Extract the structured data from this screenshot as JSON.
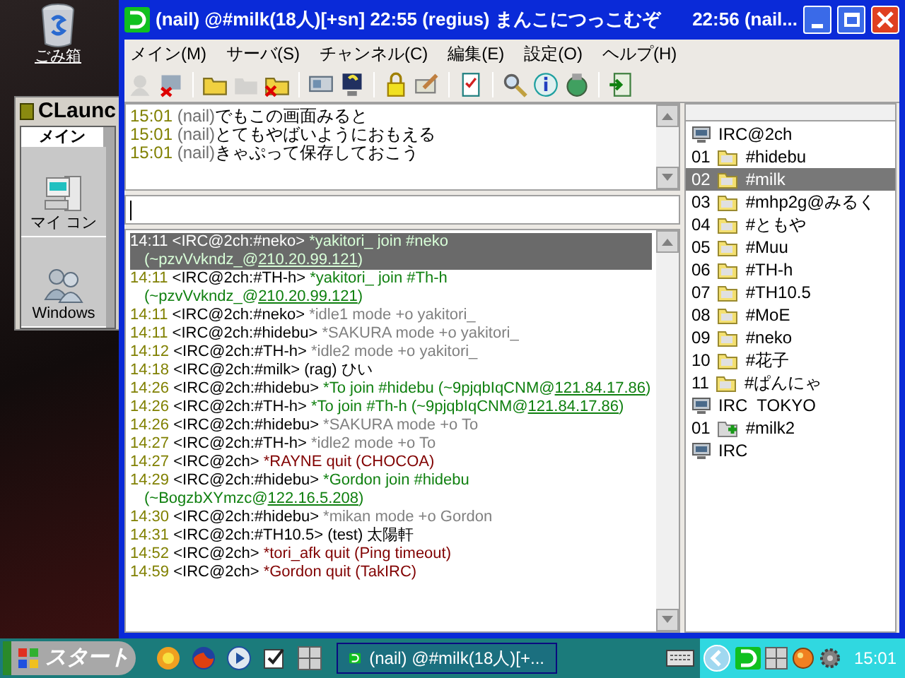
{
  "desktop": {
    "icons": [
      {
        "label": "ごみ箱"
      }
    ]
  },
  "launcher": {
    "title": "CLaunc",
    "tab": "メイン",
    "items": [
      {
        "label": "マイ コン"
      },
      {
        "label": "Windows"
      }
    ]
  },
  "window": {
    "title": "(nail) @#milk(18人)[+sn] 22:55 (regius) まんこにつっこむぞ",
    "title_right": "22:56 (nail..."
  },
  "menu": [
    "メイン(M)",
    "サーバ(S)",
    "チャンネル(C)",
    "編集(E)",
    "設定(O)",
    "ヘルプ(H)"
  ],
  "toolbar": [
    {
      "disabled": true
    },
    {
      "disabled": false
    },
    {
      "disabled": false
    },
    {
      "disabled": true
    },
    {
      "disabled": false
    },
    {
      "disabled": false
    },
    {
      "disabled": false
    },
    {
      "disabled": false
    },
    {
      "disabled": false
    },
    {
      "disabled": false
    },
    {
      "disabled": false
    },
    {
      "disabled": false
    },
    {
      "disabled": false
    },
    {
      "disabled": false
    }
  ],
  "chat": [
    {
      "time": "15:01",
      "nick": "(nail)",
      "text": "でもこの画面みると"
    },
    {
      "time": "15:01",
      "nick": "(nail)",
      "text": "とてもやばいようにおもえる"
    },
    {
      "time": "15:01",
      "nick": "(nail)",
      "text": "きゃぷって保存しておこう"
    }
  ],
  "log": [
    {
      "time": "14:11",
      "source": "<IRC@2ch:#neko>",
      "text": "*yakitori_ join #neko (~pzvVvkndz_@",
      "link": "210.20.99.121",
      "tail": ")",
      "kind": "join",
      "selected": true
    },
    {
      "time": "14:11",
      "source": "<IRC@2ch:#TH-h>",
      "text": "*yakitori_ join #Th-h (~pzvVvkndz_@",
      "link": "210.20.99.121",
      "tail": ")",
      "kind": "join",
      "selected": false
    },
    {
      "time": "14:11",
      "source": "<IRC@2ch:#neko>",
      "text": "*idle1 mode +o yakitori_",
      "kind": "mode",
      "selected": false
    },
    {
      "time": "14:11",
      "source": "<IRC@2ch:#hidebu>",
      "text": "*SAKURA mode +o yakitori_",
      "kind": "mode",
      "selected": false
    },
    {
      "time": "14:12",
      "source": "<IRC@2ch:#TH-h>",
      "text": "*idle2 mode +o yakitori_",
      "kind": "mode",
      "selected": false
    },
    {
      "time": "14:18",
      "source": "<IRC@2ch:#milk>",
      "text": "(rag) ひい",
      "kind": "message",
      "selected": false
    },
    {
      "time": "14:26",
      "source": "<IRC@2ch:#hidebu>",
      "text": "*To join #hidebu (~9pjqbIqCNM@",
      "link": "121.84.17.86",
      "tail": ")",
      "kind": "join",
      "selected": false
    },
    {
      "time": "14:26",
      "source": "<IRC@2ch:#TH-h>",
      "text": "*To join #Th-h (~9pjqbIqCNM@",
      "link": "121.84.17.86",
      "tail": ")",
      "kind": "join",
      "selected": false
    },
    {
      "time": "14:26",
      "source": "<IRC@2ch:#hidebu>",
      "text": "*SAKURA mode +o To",
      "kind": "mode",
      "selected": false
    },
    {
      "time": "14:27",
      "source": "<IRC@2ch:#TH-h>",
      "text": "*idle2 mode +o To",
      "kind": "mode",
      "selected": false
    },
    {
      "time": "14:27",
      "source": "<IRC@2ch>",
      "text": "*RAYNE quit (CHOCOA)",
      "kind": "quit",
      "selected": false
    },
    {
      "time": "14:29",
      "source": "<IRC@2ch:#hidebu>",
      "text": "*Gordon join #hidebu (~BogzbXYmzc@",
      "link": "122.16.5.208",
      "tail": ")",
      "kind": "join",
      "selected": false
    },
    {
      "time": "14:30",
      "source": "<IRC@2ch:#hidebu>",
      "text": "*mikan mode +o Gordon",
      "kind": "mode",
      "selected": false
    },
    {
      "time": "14:31",
      "source": "<IRC@2ch:#TH10.5>",
      "text": "(test) 太陽軒",
      "kind": "message",
      "selected": false
    },
    {
      "time": "14:52",
      "source": "<IRC@2ch>",
      "text": "*tori_afk quit (Ping timeout)",
      "kind": "quit",
      "selected": false
    },
    {
      "time": "14:59",
      "source": "<IRC@2ch>",
      "text": "*Gordon quit (TakIRC)",
      "kind": "quit",
      "selected": false
    }
  ],
  "channels": [
    {
      "kind": "server",
      "name": "IRC@2ch",
      "selected": false
    },
    {
      "kind": "channel",
      "number": "01",
      "name": "#hidebu",
      "selected": false
    },
    {
      "kind": "channel",
      "number": "02",
      "name": "#milk",
      "selected": true
    },
    {
      "kind": "channel",
      "number": "03",
      "name": "#mhp2g@みるく",
      "selected": false
    },
    {
      "kind": "channel",
      "number": "04",
      "name": "#ともや",
      "selected": false
    },
    {
      "kind": "channel",
      "number": "05",
      "name": "#Muu",
      "selected": false
    },
    {
      "kind": "channel",
      "number": "06",
      "name": "#TH-h",
      "selected": false
    },
    {
      "kind": "channel",
      "number": "07",
      "name": "#TH10.5",
      "selected": false
    },
    {
      "kind": "channel",
      "number": "08",
      "name": "#MoE",
      "selected": false
    },
    {
      "kind": "channel",
      "number": "09",
      "name": "#neko",
      "selected": false
    },
    {
      "kind": "channel",
      "number": "10",
      "name": "#花子",
      "selected": false
    },
    {
      "kind": "channel",
      "number": "11",
      "name": "#ぱんにゃ",
      "selected": false
    },
    {
      "kind": "server",
      "name": "IRC  TOKYO",
      "selected": false
    },
    {
      "kind": "new-channel",
      "number": "01",
      "name": "#milk2",
      "selected": false
    },
    {
      "kind": "server",
      "name": "IRC",
      "selected": false
    }
  ],
  "taskbar": {
    "start": "スタート",
    "task": "(nail) @#milk(18人)[+...",
    "clock": "15:01"
  }
}
